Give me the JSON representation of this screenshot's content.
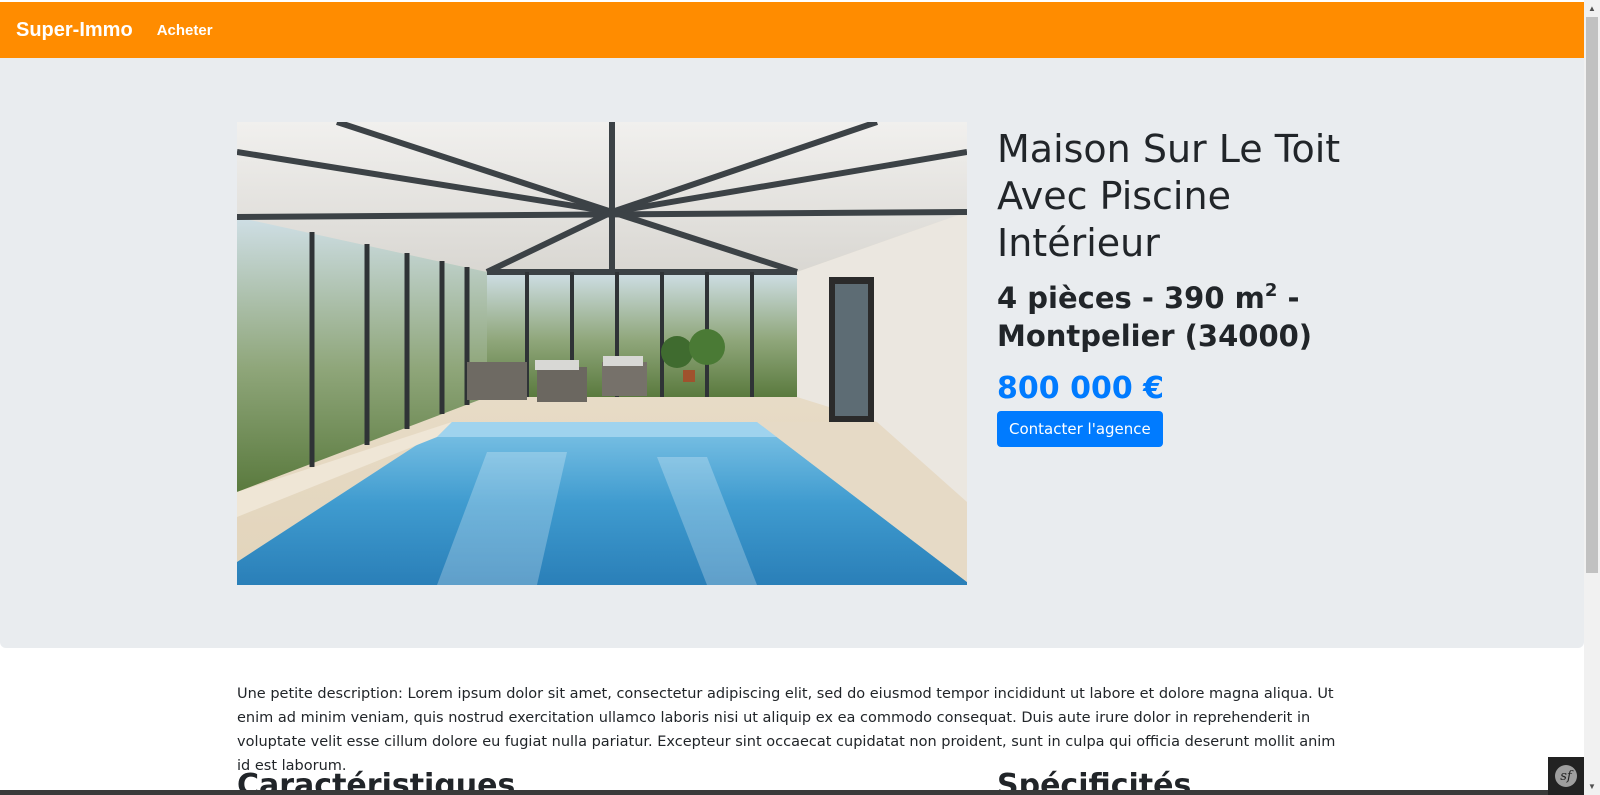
{
  "navbar": {
    "brand": "Super-Immo",
    "links": [
      {
        "label": "Acheter"
      }
    ],
    "color": "#ff8c00"
  },
  "property": {
    "title": "Maison Sur Le Toit Avec Piscine Intérieur",
    "rooms": "4 pièces",
    "area": "390 m",
    "area_sup": "2",
    "location": "Montpelier (34000)",
    "price": "800 000 €",
    "contact_label": "Contacter l'agence",
    "image_alt": "indoor-pool-photo"
  },
  "description": "Une petite description: Lorem ipsum dolor sit amet, consectetur adipiscing elit, sed do eiusmod tempor incididunt ut labore et dolore magna aliqua. Ut enim ad minim veniam, quis nostrud exercitation ullamco laboris nisi ut aliquip ex ea commodo consequat. Duis aute irure dolor in reprehenderit in voluptate velit esse cillum dolore eu fugiat nulla pariatur. Excepteur sint occaecat cupidatat non proident, sunt in culpa qui officia deserunt mollit anim id est laborum.",
  "sections": {
    "left_heading": "Caractéristiques",
    "right_heading": "Spécificités"
  },
  "colors": {
    "accent": "#007bff",
    "jumbotron_bg": "#e9ecef"
  }
}
